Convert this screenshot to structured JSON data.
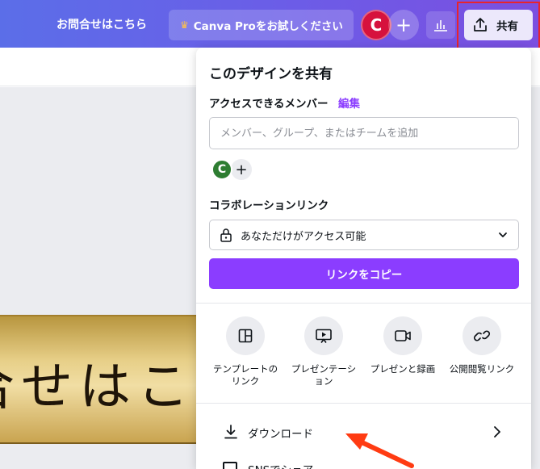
{
  "topbar": {
    "contact_label": "お問合せはこちら",
    "pro_label": "Canva Proをお試しください",
    "avatar_initial": "C",
    "share_label": "共有"
  },
  "canvas": {
    "banner_text": "合せはこ"
  },
  "share_panel": {
    "title": "このデザインを共有",
    "members_label": "アクセスできるメンバー",
    "edit_link": "編集",
    "member_input_placeholder": "メンバー、グループ、またはチームを追加",
    "member_avatar_initial": "C",
    "collab_link_label": "コラボレーションリンク",
    "access_select_value": "あなただけがアクセス可能",
    "copy_link_button": "リンクをコピー",
    "options": [
      {
        "label_line1": "テンプレートの",
        "label_line2": "リンク",
        "icon": "template-icon"
      },
      {
        "label_line1": "プレゼンテーシ",
        "label_line2": "ョン",
        "icon": "presentation-icon"
      },
      {
        "label_line1": "プレゼンと録画",
        "label_line2": "",
        "icon": "video-icon"
      },
      {
        "label_line1": "公開閲覧リンク",
        "label_line2": "",
        "icon": "link-icon"
      }
    ],
    "download_label": "ダウンロード",
    "next_row_label": "SNSでシェア"
  },
  "colors": {
    "accent": "#8b3dff",
    "avatar_red": "#d6123d",
    "avatar_green": "#2e7d32",
    "annotation_red": "#e8242c",
    "arrow_orange": "#ff3b12"
  }
}
